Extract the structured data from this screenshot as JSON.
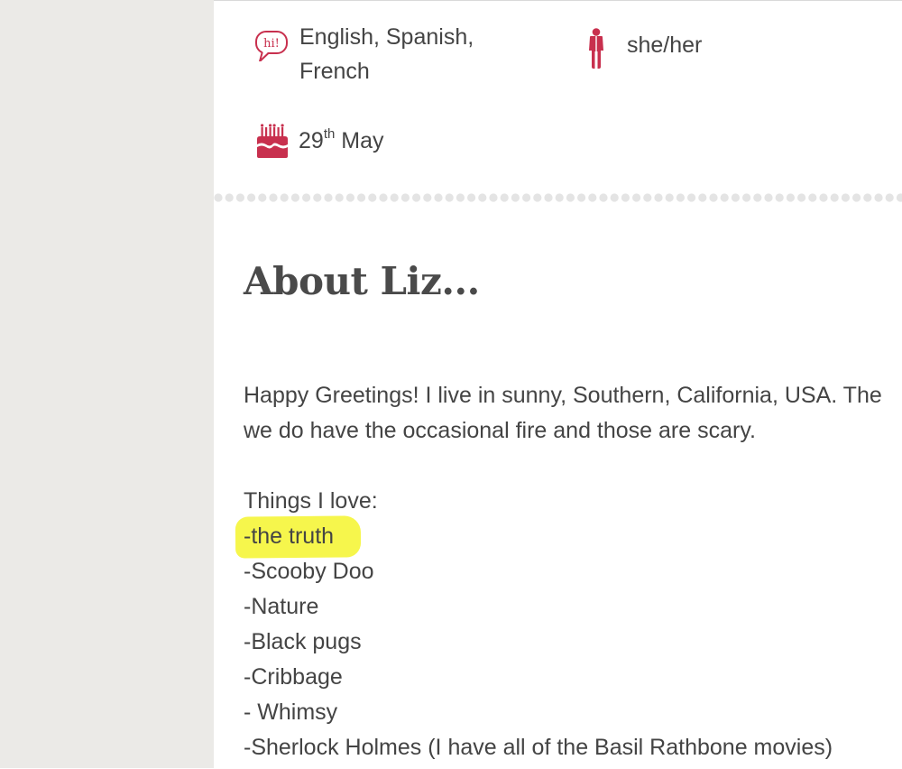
{
  "colors": {
    "accent": "#c8304e",
    "sidebar": "#ebeae7",
    "text": "#444444",
    "highlight": "#f5f542"
  },
  "profile": {
    "languages": {
      "icon": "speech-bubble-hi-icon",
      "badge_text": "hi!",
      "line1": "English, Spanish,",
      "line2": "French"
    },
    "pronouns": {
      "icon": "person-icon",
      "text": "she/her"
    },
    "birthday": {
      "icon": "birthday-cake-icon",
      "day": "29",
      "suffix": "th",
      "month": "May"
    }
  },
  "about": {
    "title": "About Liz...",
    "intro_line1": "Happy Greetings! I live in sunny, Southern, California, USA. The",
    "intro_line2": "we do have the occasional fire and those are scary.",
    "loves_heading": "Things I love:",
    "loves": [
      "-the truth",
      "-Scooby Doo",
      "-Nature",
      "-Black pugs",
      "-Cribbage",
      "- Whimsy",
      "-Sherlock Holmes (I have all of the Basil Rathbone movies)"
    ]
  }
}
